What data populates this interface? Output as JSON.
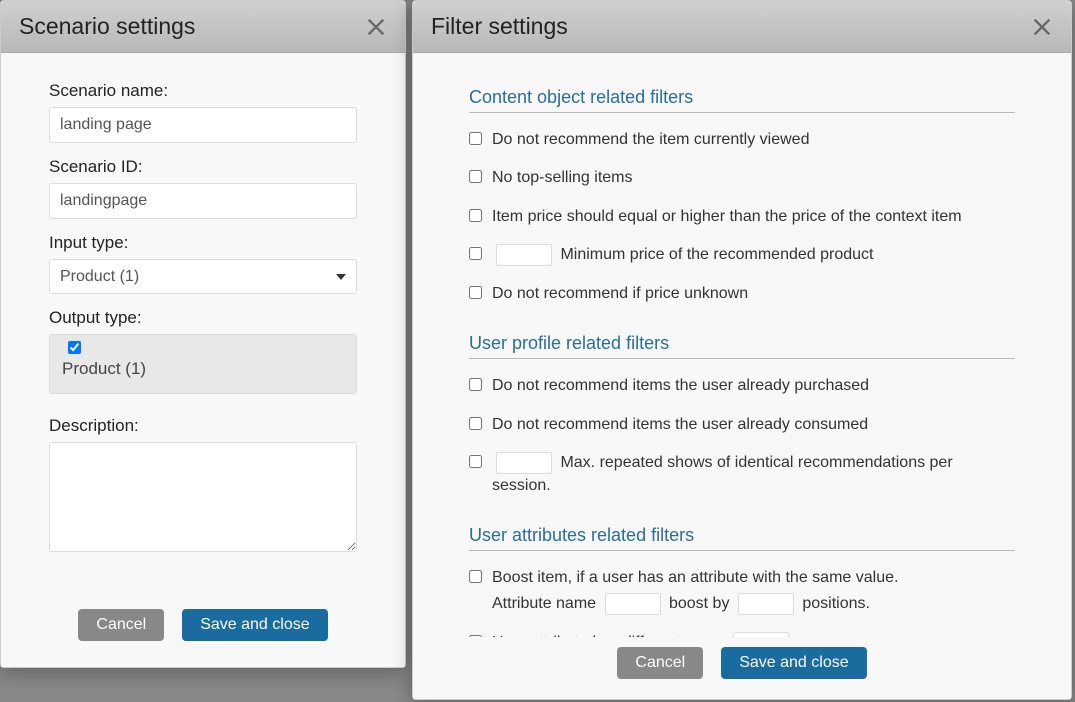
{
  "scenario_modal": {
    "title": "Scenario settings",
    "fields": {
      "name_label": "Scenario name:",
      "name_value": "landing page",
      "id_label": "Scenario ID:",
      "id_value": "landingpage",
      "input_type_label": "Input type:",
      "input_type_value": "Product (1)",
      "output_type_label": "Output type:",
      "output_type_value": "Product (1)",
      "description_label": "Description:"
    },
    "buttons": {
      "cancel": "Cancel",
      "save": "Save and close"
    }
  },
  "filter_modal": {
    "title": "Filter settings",
    "sections": {
      "content": {
        "title": "Content object related filters",
        "items": {
          "no_current": "Do not recommend the item currently viewed",
          "no_top": "No top-selling items",
          "price_equal": "Item price should equal or higher than the price of the context item",
          "min_price_suffix": "Minimum price of the recommended product",
          "no_unknown": "Do not recommend if price unknown"
        }
      },
      "user_profile": {
        "title": "User profile related filters",
        "items": {
          "already_purchased": "Do not recommend items the user already purchased",
          "already_consumed": "Do not recommend items the user already consumed",
          "max_repeated_suffix": "Max. repeated shows of identical recommendations per session."
        }
      },
      "user_attributes": {
        "title": "User attributes related filters",
        "items": {
          "boost_line1": "Boost item, if a user has an attribute with the same value.",
          "boost_attr_name": "Attribute name",
          "boost_by": "boost by",
          "boost_positions": "positions.",
          "diff_name": "User attribute has different name"
        }
      }
    },
    "buttons": {
      "cancel": "Cancel",
      "save": "Save and close"
    }
  }
}
